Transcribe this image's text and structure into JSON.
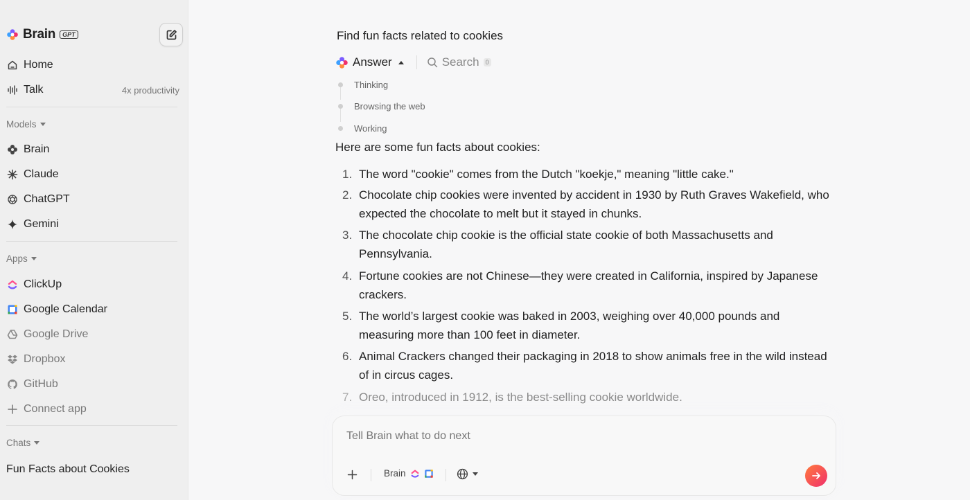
{
  "sidebar": {
    "brand": {
      "name": "Brain",
      "badge": "GPT"
    },
    "nav": [
      {
        "label": "Home",
        "icon": "home-icon"
      },
      {
        "label": "Talk",
        "icon": "audio-wave-icon",
        "right": "4x productivity"
      }
    ],
    "models_label": "Models",
    "models": [
      {
        "label": "Brain",
        "icon": "brain-icon"
      },
      {
        "label": "Claude",
        "icon": "claude-icon"
      },
      {
        "label": "ChatGPT",
        "icon": "chatgpt-icon"
      },
      {
        "label": "Gemini",
        "icon": "gemini-icon"
      }
    ],
    "apps_label": "Apps",
    "apps": [
      {
        "label": "ClickUp",
        "icon": "clickup-icon"
      },
      {
        "label": "Google Calendar",
        "icon": "google-calendar-icon"
      },
      {
        "label": "Google Drive",
        "icon": "google-drive-icon"
      },
      {
        "label": "Dropbox",
        "icon": "dropbox-icon"
      },
      {
        "label": "GitHub",
        "icon": "github-icon"
      },
      {
        "label": "Connect app",
        "icon": "plus-icon"
      }
    ],
    "chats_label": "Chats",
    "chats": [
      {
        "label": "Fun Facts about Cookies"
      }
    ]
  },
  "conversation": {
    "question": "Find fun facts related to cookies",
    "tabs": {
      "answer": "Answer",
      "search": "Search",
      "search_count": "0"
    },
    "steps": [
      "Thinking",
      "Browsing the web",
      "Working"
    ],
    "intro": "Here are some fun facts about cookies:",
    "facts": [
      {
        "num": "1.",
        "text": "The word \"cookie\" comes from the Dutch \"koekje,\" meaning \"little cake.\""
      },
      {
        "num": "2.",
        "line1": "Chocolate chip cookies were invented by accident in 1930 by Ruth Graves Wakefield, who",
        "line2": "expected the chocolate to melt but it stayed in chunks."
      },
      {
        "num": "3.",
        "line1": "The chocolate chip cookie is the official state cookie of both Massachusetts and",
        "line2": "Pennsylvania."
      },
      {
        "num": "4.",
        "line1": "Fortune cookies are not Chinese—they were created in California, inspired by Japanese",
        "line2": "crackers."
      },
      {
        "num": "5.",
        "line1": "The world’s largest cookie was baked in 2003, weighing over 40,000 pounds and",
        "line2": "measuring more than 100 feet in diameter."
      },
      {
        "num": "6.",
        "line1": "Animal Crackers changed their packaging in 2018 to show animals free in the wild instead",
        "line2": "of in circus cages."
      },
      {
        "num": "7.",
        "text": "Oreo, introduced in 1912, is the best-selling cookie worldwide."
      }
    ]
  },
  "composer": {
    "placeholder": "Tell Brain what to do next",
    "model_label": "Brain"
  },
  "colors": {
    "send_gradient_start": "#ff7a3d",
    "send_gradient_end": "#f0306c",
    "brand_pink": "#e6407a",
    "brand_purple": "#7b5cff"
  }
}
